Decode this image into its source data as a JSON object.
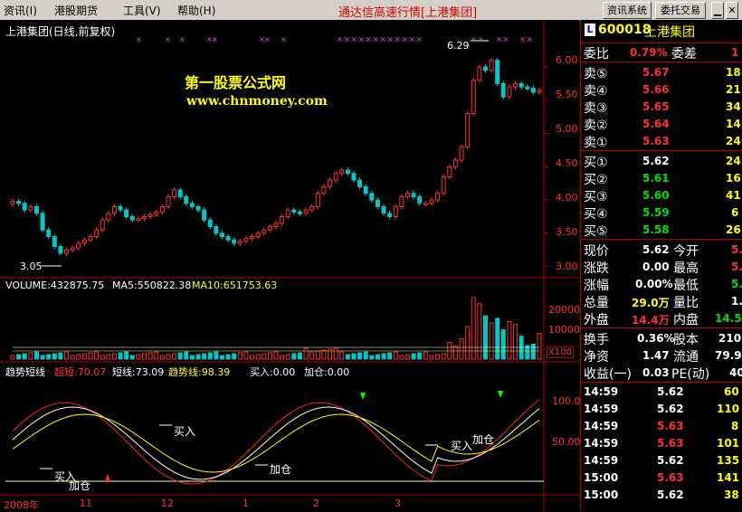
{
  "menu": {
    "items": [
      "资讯(I)",
      "港股期货",
      "工具(V)",
      "帮助(H)"
    ],
    "app_title": "通达信高速行情[上港集团]",
    "info_button": "资讯系统",
    "trade_button": "委托交易"
  },
  "chart": {
    "title": "上港集团(日线,前复权)",
    "watermark_name": "第一股票公式网",
    "watermark_url": "www.chnmoney.com",
    "high_label": "6.29",
    "low_label": "3.05",
    "price_axis": [
      "6.00",
      "5.50",
      "5.00",
      "4.50",
      "4.00",
      "3.50",
      "3.00"
    ],
    "volume_info": {
      "volume": "VOLUME:432875.75",
      "ma5": "MA5:550822.38",
      "ma10": "MA10:651753.63"
    },
    "volume_axis": [
      "20000",
      "10000"
    ],
    "volume_unit": "X100",
    "indicator_info": {
      "name": "趋势短线",
      "super_short": "超短:70.07",
      "short": "短线:73.09",
      "trend": "趋势线:98.39",
      "buy": "买入:0.00",
      "add": "加仓:0.00"
    },
    "indicator_axis": [
      "100.0",
      "50.00"
    ],
    "signals": [
      {
        "text": "买入",
        "kind": "buy"
      },
      {
        "text": "加仓",
        "kind": "add"
      },
      {
        "text": "买入",
        "kind": "buy"
      },
      {
        "text": "加仓",
        "kind": "add"
      },
      {
        "text": "买入",
        "kind": "buy"
      },
      {
        "text": "加仓",
        "kind": "add"
      }
    ],
    "dates": [
      "2008年",
      "11",
      "12",
      "1",
      "2",
      "3"
    ]
  },
  "chart_data": {
    "type": "candlestick",
    "title": "上港集团(日线,前复权)",
    "ylim": [
      2.9,
      6.3
    ],
    "high": 6.29,
    "low": 3.05,
    "closes": [
      3.98,
      3.95,
      3.85,
      3.9,
      3.8,
      3.55,
      3.45,
      3.3,
      3.2,
      3.25,
      3.28,
      3.35,
      3.4,
      3.45,
      3.55,
      3.7,
      3.8,
      3.9,
      3.85,
      3.75,
      3.7,
      3.72,
      3.75,
      3.78,
      3.82,
      3.9,
      4.05,
      4.15,
      4.05,
      3.95,
      3.9,
      3.85,
      3.7,
      3.6,
      3.5,
      3.45,
      3.4,
      3.35,
      3.38,
      3.42,
      3.45,
      3.5,
      3.55,
      3.6,
      3.65,
      3.75,
      3.85,
      3.82,
      3.8,
      3.85,
      3.9,
      4.1,
      4.2,
      4.3,
      4.4,
      4.45,
      4.4,
      4.3,
      4.2,
      4.1,
      4.0,
      3.9,
      3.8,
      3.75,
      3.9,
      4.05,
      4.1,
      4.05,
      3.95,
      3.95,
      4.0,
      4.1,
      4.35,
      4.5,
      4.6,
      4.8,
      5.3,
      5.8,
      6.0,
      5.95,
      6.1,
      5.75,
      5.55,
      5.7,
      5.75,
      5.7,
      5.68,
      5.62,
      5.65
    ]
  },
  "quote": {
    "code": "600018",
    "name": "上港集团",
    "weibi_label": "委比",
    "weibi_value": "0.79%",
    "weicha_label": "委差",
    "weicha_value": "1",
    "asks": [
      {
        "label": "卖⑤",
        "price": "5.67",
        "vol": "18"
      },
      {
        "label": "卖④",
        "price": "5.66",
        "vol": "21"
      },
      {
        "label": "卖③",
        "price": "5.65",
        "vol": "34"
      },
      {
        "label": "卖②",
        "price": "5.64",
        "vol": "14"
      },
      {
        "label": "卖①",
        "price": "5.63",
        "vol": "24"
      }
    ],
    "bids": [
      {
        "label": "买①",
        "price": "5.62",
        "vol": "24"
      },
      {
        "label": "买②",
        "price": "5.61",
        "vol": "16"
      },
      {
        "label": "买③",
        "price": "5.60",
        "vol": "41"
      },
      {
        "label": "买④",
        "price": "5.59",
        "vol": "6"
      },
      {
        "label": "买⑤",
        "price": "5.58",
        "vol": "26"
      }
    ],
    "stats": [
      {
        "l1": "现价",
        "v1": "5.62",
        "l2": "今开",
        "v2": "5."
      },
      {
        "l1": "涨跌",
        "v1": "0.00",
        "l2": "最高",
        "v2": "5."
      },
      {
        "l1": "涨幅",
        "v1": "0.00%",
        "l2": "最低",
        "v2": "5."
      },
      {
        "l1": "总量",
        "v1": "29.0万",
        "l2": "量比",
        "v2": "1."
      },
      {
        "l1": "外盘",
        "v1": "14.4万",
        "l2": "内盘",
        "v2": "14.5"
      }
    ],
    "fin": [
      {
        "l1": "换手",
        "v1": "0.36%",
        "l2": "股本",
        "v2": "210"
      },
      {
        "l1": "净资",
        "v1": "1.47",
        "l2": "流通",
        "v2": "79.9"
      },
      {
        "l1": "收益(一)",
        "v1": "0.03",
        "l2": "PE(动)",
        "v2": "40"
      }
    ],
    "ticks": [
      {
        "time": "14:59",
        "price": "5.62",
        "vol": "60"
      },
      {
        "time": "14:59",
        "price": "5.62",
        "vol": "110"
      },
      {
        "time": "14:59",
        "price": "5.63",
        "vol": "8"
      },
      {
        "time": "14:59",
        "price": "5.63",
        "vol": "101"
      },
      {
        "time": "14:59",
        "price": "5.62",
        "vol": "135"
      },
      {
        "time": "15:00",
        "price": "5.63",
        "vol": "141"
      },
      {
        "time": "15:00",
        "price": "5.62",
        "vol": "38"
      }
    ]
  }
}
